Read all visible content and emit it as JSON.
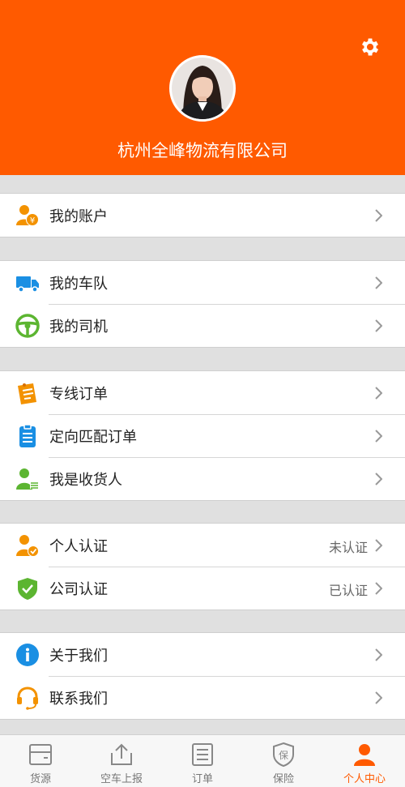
{
  "header": {
    "company_name": "杭州全峰物流有限公司"
  },
  "menu": {
    "account": {
      "label": "我的账户"
    },
    "fleet": {
      "label": "我的车队"
    },
    "drivers": {
      "label": "我的司机"
    },
    "line_orders": {
      "label": "专线订单"
    },
    "directed_orders": {
      "label": "定向匹配订单"
    },
    "consignee": {
      "label": "我是收货人"
    },
    "personal_auth": {
      "label": "个人认证",
      "status": "未认证"
    },
    "company_auth": {
      "label": "公司认证",
      "status": "已认证"
    },
    "about": {
      "label": "关于我们"
    },
    "contact": {
      "label": "联系我们"
    }
  },
  "tabbar": {
    "tabs": [
      {
        "label": "货源",
        "icon": "cargo-icon"
      },
      {
        "label": "空车上报",
        "icon": "upload-icon"
      },
      {
        "label": "订单",
        "icon": "order-list-icon"
      },
      {
        "label": "保险",
        "icon": "insurance-shield-icon"
      },
      {
        "label": "个人中心",
        "icon": "person-icon"
      }
    ],
    "active_index": 4
  },
  "colors": {
    "brand": "#ff5a00",
    "blue": "#1a8fe3",
    "green": "#5cb531",
    "orange": "#f39200"
  }
}
